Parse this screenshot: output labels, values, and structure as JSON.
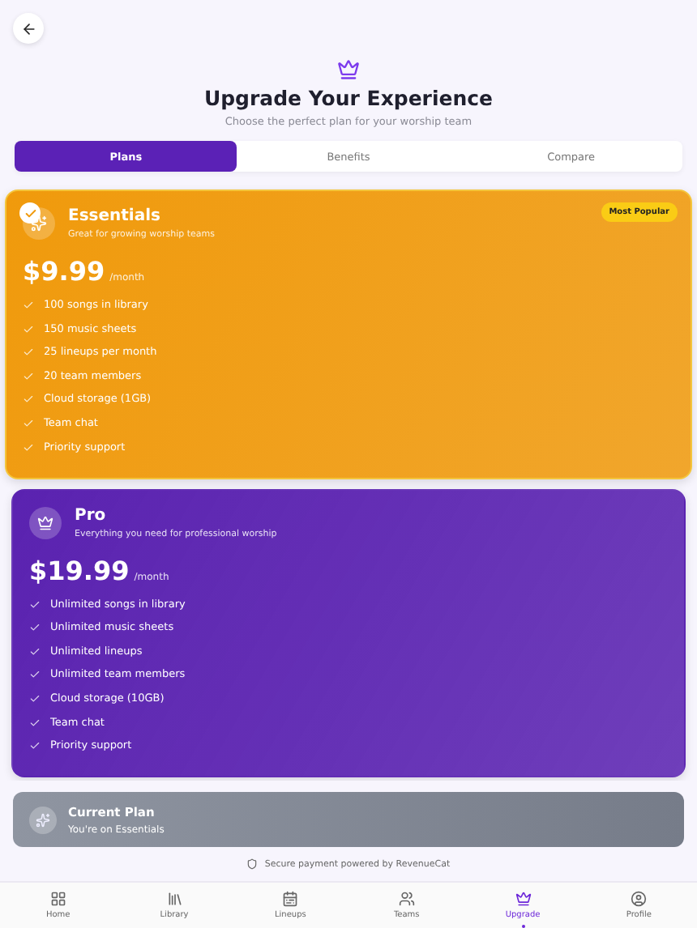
{
  "header": {
    "title": "Upgrade Your Experience",
    "subtitle": "Choose the perfect plan for your worship team"
  },
  "tabs": [
    {
      "label": "Plans",
      "selected": true
    },
    {
      "label": "Benefits",
      "selected": false
    },
    {
      "label": "Compare",
      "selected": false
    }
  ],
  "plans": [
    {
      "name": "Essentials",
      "description": "Great for growing worship teams",
      "price": "$9.99",
      "period": "/month",
      "badge": "Most Popular",
      "selected": true,
      "color": "#f09a0c",
      "features": [
        "100 songs in library",
        "150 music sheets",
        "25 lineups per month",
        "20 team members",
        "Cloud storage (1GB)",
        "Team chat",
        "Priority support"
      ]
    },
    {
      "name": "Pro",
      "description": "Everything you need for professional worship",
      "price": "$19.99",
      "period": "/month",
      "selected": false,
      "color": "#5a22b0",
      "features": [
        "Unlimited songs in library",
        "Unlimited music sheets",
        "Unlimited lineups",
        "Unlimited team members",
        "Cloud storage (10GB)",
        "Team chat",
        "Priority support"
      ]
    }
  ],
  "current_plan": {
    "title": "Current Plan",
    "subtitle": "You're on Essentials",
    "disabled": true
  },
  "secure_note": "Secure payment powered by RevenueCat",
  "nav": [
    {
      "label": "Home",
      "selected": false
    },
    {
      "label": "Library",
      "selected": false
    },
    {
      "label": "Lineups",
      "selected": false
    },
    {
      "label": "Teams",
      "selected": false
    },
    {
      "label": "Upgrade",
      "selected": true
    },
    {
      "label": "Profile",
      "selected": false
    }
  ]
}
